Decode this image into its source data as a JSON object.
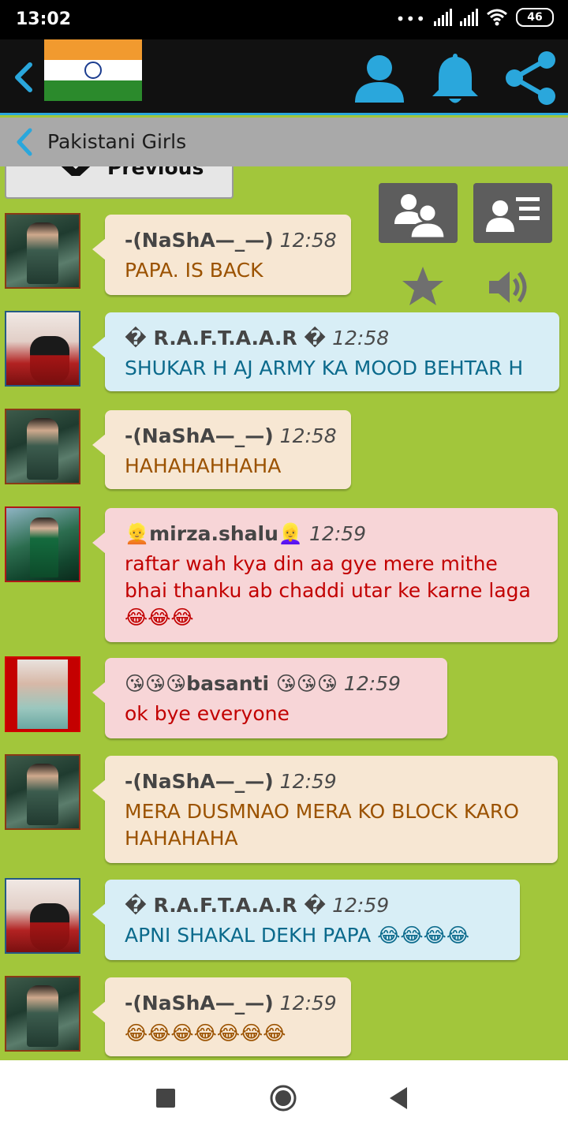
{
  "status_bar": {
    "time": "13:02",
    "dots": "•••",
    "battery": "46"
  },
  "header": {
    "flag_icon": "india-flag-icon",
    "icons": [
      "back-icon",
      "profile-icon",
      "bell-icon",
      "share-icon"
    ],
    "accent": "#2aa7dc"
  },
  "subheader": {
    "room_name": "Pakistani Girls"
  },
  "previous_button": {
    "label": "Previous"
  },
  "side_tools": {
    "icons": [
      "users-icon",
      "user-list-icon",
      "star-icon",
      "speaker-icon"
    ]
  },
  "messages": [
    {
      "user": "-(NaShA—_—)",
      "time": "12:58",
      "text": "PAPA. IS BACK",
      "style": "beige"
    },
    {
      "user": "� R.A.F.T.A.A.R �",
      "time": "12:58",
      "text": "SHUKAR H AJ ARMY KA MOOD BEHTAR H",
      "style": "blue"
    },
    {
      "user": "-(NaShA—_—)",
      "time": "12:58",
      "text": "HAHAHAHHAHA",
      "style": "beige"
    },
    {
      "user": "👱mirza.shalu👱‍♀️",
      "time": "12:59",
      "text": "raftar wah kya din aa gye mere mithe bhai thanku ab chaddi utar ke karne laga😂😂😂",
      "style": "pink"
    },
    {
      "user": "😘😘😘basanti 😘😘😘",
      "time": "12:59",
      "text": "ok bye everyone",
      "style": "pink"
    },
    {
      "user": "-(NaShA—_—)",
      "time": "12:59",
      "text": "MERA DUSMNAO MERA KO BLOCK KARO HAHAHAHA",
      "style": "beige"
    },
    {
      "user": "� R.A.F.T.A.A.R �",
      "time": "12:59",
      "text": "APNI SHAKAL DEKH PAPA 😂😂😂😂",
      "style": "blue"
    },
    {
      "user": "-(NaShA—_—)",
      "time": "12:59",
      "text": "😂😂😂😂😂😂😂",
      "style": "beige"
    }
  ],
  "nav_bar": {
    "icons": [
      "recents-icon",
      "home-icon",
      "back-nav-icon"
    ]
  }
}
